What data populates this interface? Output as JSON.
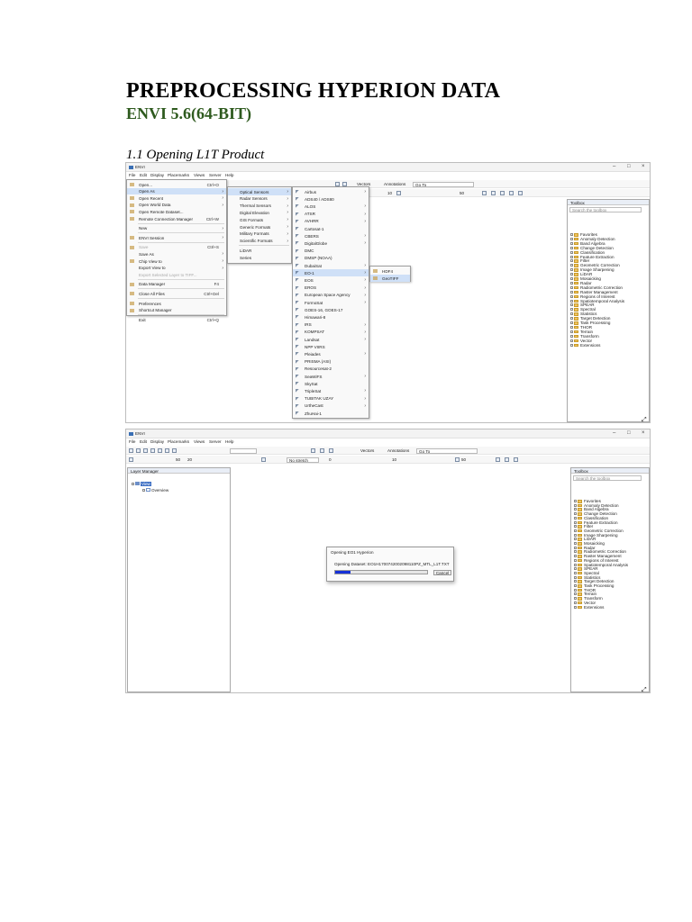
{
  "document": {
    "title": "PREPROCESSING HYPERION DATA",
    "subtitle": "ENVI 5.6(64-BIT)",
    "section_heading": "1.1  Opening L1T Product"
  },
  "envi_window": {
    "app_name": "ENVI",
    "menubar": [
      "File",
      "Edit",
      "Display",
      "Placemarks",
      "Views",
      "Server",
      "Help"
    ],
    "vectors_label": "Vectors",
    "annotations_label": "Annotations",
    "goto_label": "Go To",
    "zoom_value": "10",
    "stretch_value": "No stretch",
    "zero_value": "0",
    "value_50": "50",
    "value_20": "20",
    "layer_manager": {
      "title": "Layer Manager",
      "root": "View",
      "child": "Overview"
    },
    "toolbox": {
      "title": "Toolbox",
      "search_placeholder": "Search the toolbox",
      "items": [
        "Favorites",
        "Anomaly Detection",
        "Band Algebra",
        "Change Detection",
        "Classification",
        "Feature Extraction",
        "Filter",
        "Geometric Correction",
        "Image Sharpening",
        "LiDAR",
        "Mosaicking",
        "Radar",
        "Radiometric Correction",
        "Raster Management",
        "Regions of Interest",
        "Spatiotemporal Analysis",
        "SPEAR",
        "Spectral",
        "Statistics",
        "Target Detection",
        "Task Processing",
        "THOR",
        "Terrain",
        "Transform",
        "Vector",
        "Extensions"
      ]
    }
  },
  "file_menu": [
    {
      "label": "Open...",
      "accel": "Ctrl+O",
      "arrow": false,
      "icon": "open-folder-icon"
    },
    {
      "label": "Open As",
      "accel": "",
      "arrow": true,
      "icon": "",
      "highlight": true
    },
    {
      "label": "Open Recent",
      "accel": "",
      "arrow": true,
      "icon": "recent-icon"
    },
    {
      "label": "Open World Data",
      "accel": "",
      "arrow": true,
      "icon": "world-icon"
    },
    {
      "label": "Open Remote Dataset...",
      "accel": "",
      "arrow": false,
      "icon": "remote-icon"
    },
    {
      "label": "Remote Connection Manager",
      "accel": "Ctrl+W",
      "arrow": false,
      "icon": "connection-icon"
    },
    {
      "label": "New",
      "accel": "",
      "arrow": true,
      "icon": "",
      "sep_before": true
    },
    {
      "label": "ENVI Session",
      "accel": "",
      "arrow": true,
      "icon": "session-icon",
      "sep_before": true
    },
    {
      "label": "Save",
      "accel": "Ctrl+S",
      "arrow": false,
      "icon": "save-icon",
      "disabled": true,
      "sep_before": true
    },
    {
      "label": "Save As",
      "accel": "",
      "arrow": true,
      "icon": ""
    },
    {
      "label": "Chip View to",
      "accel": "",
      "arrow": true,
      "icon": "chip-icon"
    },
    {
      "label": "Export View to",
      "accel": "",
      "arrow": true,
      "icon": ""
    },
    {
      "label": "Export Selected Layer to TIFF...",
      "accel": "",
      "arrow": false,
      "icon": "",
      "disabled": true
    },
    {
      "label": "Data Manager",
      "accel": "F4",
      "arrow": false,
      "icon": "data-manager-icon",
      "sep_before": true
    },
    {
      "label": "Close All Files",
      "accel": "Ctrl+Del",
      "arrow": false,
      "icon": "close-files-icon",
      "sep_before": true
    },
    {
      "label": "Preferences",
      "accel": "",
      "arrow": false,
      "icon": "preferences-icon",
      "sep_before": true
    },
    {
      "label": "Shortcut Manager",
      "accel": "",
      "arrow": false,
      "icon": "shortcut-icon"
    },
    {
      "label": "Exit",
      "accel": "Ctrl+Q",
      "arrow": false,
      "icon": "",
      "sep_before": true
    }
  ],
  "open_as_menu": [
    {
      "label": "Optical Sensors",
      "arrow": true,
      "highlight": true
    },
    {
      "label": "Radar Sensors",
      "arrow": true
    },
    {
      "label": "Thermal Sensors",
      "arrow": true
    },
    {
      "label": "Digital Elevation",
      "arrow": true
    },
    {
      "label": "GIS Formats",
      "arrow": true
    },
    {
      "label": "Generic Formats",
      "arrow": true
    },
    {
      "label": "Military Formats",
      "arrow": true
    },
    {
      "label": "Scientific Formats",
      "arrow": true
    },
    {
      "label": "LiDAR",
      "arrow": false,
      "sep_before": true
    },
    {
      "label": "Series",
      "arrow": false
    }
  ],
  "optical_menu": [
    {
      "label": "Airbus",
      "arrow": true
    },
    {
      "label": "ADS40 / ADS80",
      "arrow": false
    },
    {
      "label": "ALOS",
      "arrow": true
    },
    {
      "label": "ATSR",
      "arrow": true
    },
    {
      "label": "AVHRR",
      "arrow": true
    },
    {
      "label": "Cartosat-1",
      "arrow": false
    },
    {
      "label": "CBERS",
      "arrow": true
    },
    {
      "label": "DigitalGlobe",
      "arrow": true
    },
    {
      "label": "DMC",
      "arrow": false
    },
    {
      "label": "DMSP (NOAA)",
      "arrow": false
    },
    {
      "label": "DubaiSat",
      "arrow": true
    },
    {
      "label": "EO-1",
      "arrow": true,
      "highlight": true
    },
    {
      "label": "EOS",
      "arrow": true
    },
    {
      "label": "EROS",
      "arrow": true
    },
    {
      "label": "European Space Agency",
      "arrow": true
    },
    {
      "label": "FormoSat",
      "arrow": true
    },
    {
      "label": "GOES-16, GOES-17",
      "arrow": false
    },
    {
      "label": "Himawari-8",
      "arrow": false
    },
    {
      "label": "IRS",
      "arrow": true
    },
    {
      "label": "KOMPSAT",
      "arrow": true
    },
    {
      "label": "Landsat",
      "arrow": true
    },
    {
      "label": "NPP VIIRS",
      "arrow": false
    },
    {
      "label": "Pleiades",
      "arrow": true
    },
    {
      "label": "PRISMA (ASI)",
      "arrow": false
    },
    {
      "label": "Resourcesat-2",
      "arrow": false
    },
    {
      "label": "SeaWiFS",
      "arrow": true
    },
    {
      "label": "SkySat",
      "arrow": false
    },
    {
      "label": "TripleSat",
      "arrow": true
    },
    {
      "label": "TUBITAK UZAY",
      "arrow": true
    },
    {
      "label": "UrtheCast",
      "arrow": true
    },
    {
      "label": "ZhuHai-1",
      "arrow": false
    }
  ],
  "eo1_menu": [
    {
      "label": "HDF4",
      "highlight": false
    },
    {
      "label": "GeoTIFF",
      "highlight": true
    }
  ],
  "dialog": {
    "title": "Opening EO1 Hyperion",
    "message": "Opening Dataset: EO1H1700742002098110PZ_MTL_L1T.TXT",
    "cancel_label": "Cancel",
    "progress": 0.17
  },
  "colors": {
    "subtitle": "#2e5a1e",
    "highlight": "#cfe0f7",
    "progress": "#1530d8"
  }
}
